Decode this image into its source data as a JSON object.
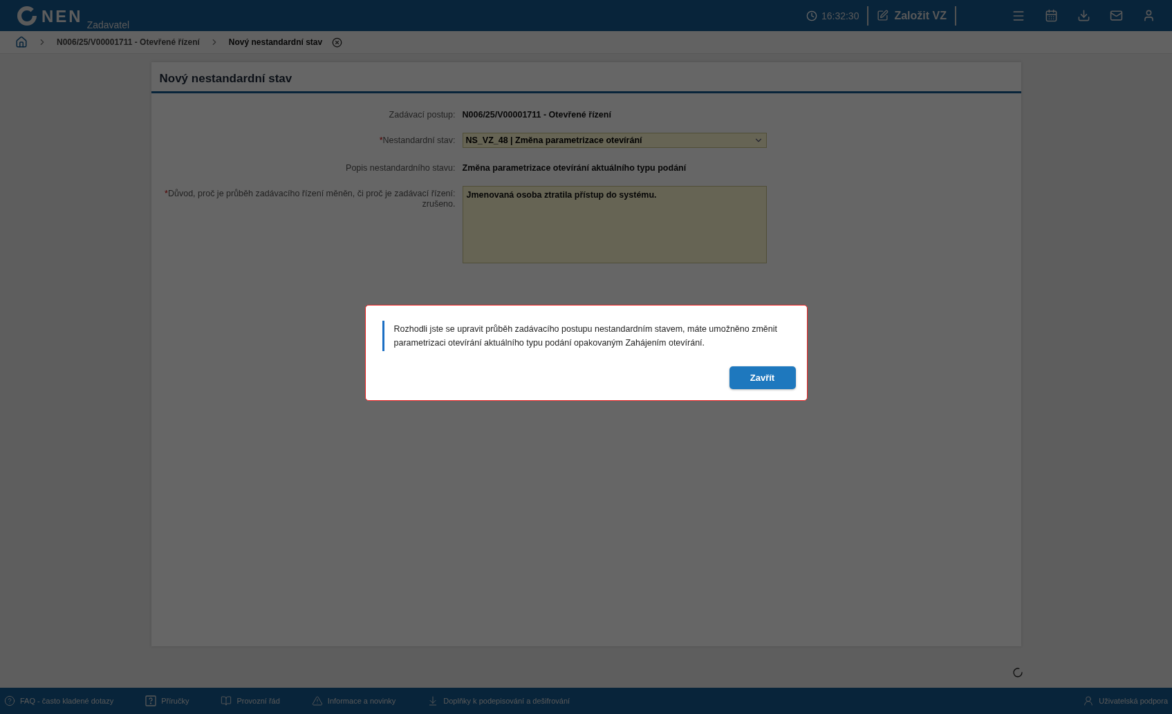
{
  "header": {
    "logo_text": "NEN",
    "role": "Zadavatel",
    "time": "16:32:30",
    "create_button": "Založit VZ"
  },
  "breadcrumb": {
    "items": [
      {
        "label": "N006/25/V00001711 - Otevřené řízení",
        "current": false
      },
      {
        "label": "Nový nestandardní stav",
        "current": true
      }
    ]
  },
  "form": {
    "title": "Nový nestandardní stav",
    "fields": [
      {
        "kind": "text",
        "label": "Zadávací postup:",
        "value": "N006/25/V00001711 - Otevřené řízení"
      },
      {
        "kind": "select",
        "required_mark": "*",
        "label": "Nestandardní stav:",
        "value": "NS_VZ_48 | Změna parametrizace otevírání"
      },
      {
        "kind": "text",
        "label": "Popis nestandardního stavu:",
        "value": "Změna parametrizace otevírání aktuálního typu podání"
      },
      {
        "kind": "textarea",
        "required_mark": "*",
        "label": "Důvod, proč je průběh zadávacího řízení měněn, či proč je zadávací řízení: zrušeno.",
        "value": "Jmenovaná osoba ztratila přístup do systému."
      }
    ]
  },
  "dialog": {
    "message": "Rozhodli jste se upravit průběh zadávacího postupu nestandardním stavem, máte umožněno změnit parametrizaci otevírání aktuálního typu podání opakovaným Zahájením otevírání.",
    "button": "Zavřít"
  },
  "footer": {
    "links": [
      {
        "kind": "faq",
        "label": "FAQ - často kladené dotazy"
      },
      {
        "kind": "manual",
        "label": "Příručky"
      },
      {
        "kind": "book",
        "label": "Provozní řád"
      },
      {
        "kind": "warning",
        "label": "Informace a novinky"
      },
      {
        "kind": "download",
        "label": "Doplňky k podepisování a dešifrování"
      }
    ],
    "support": "Uživatelská podpora"
  }
}
